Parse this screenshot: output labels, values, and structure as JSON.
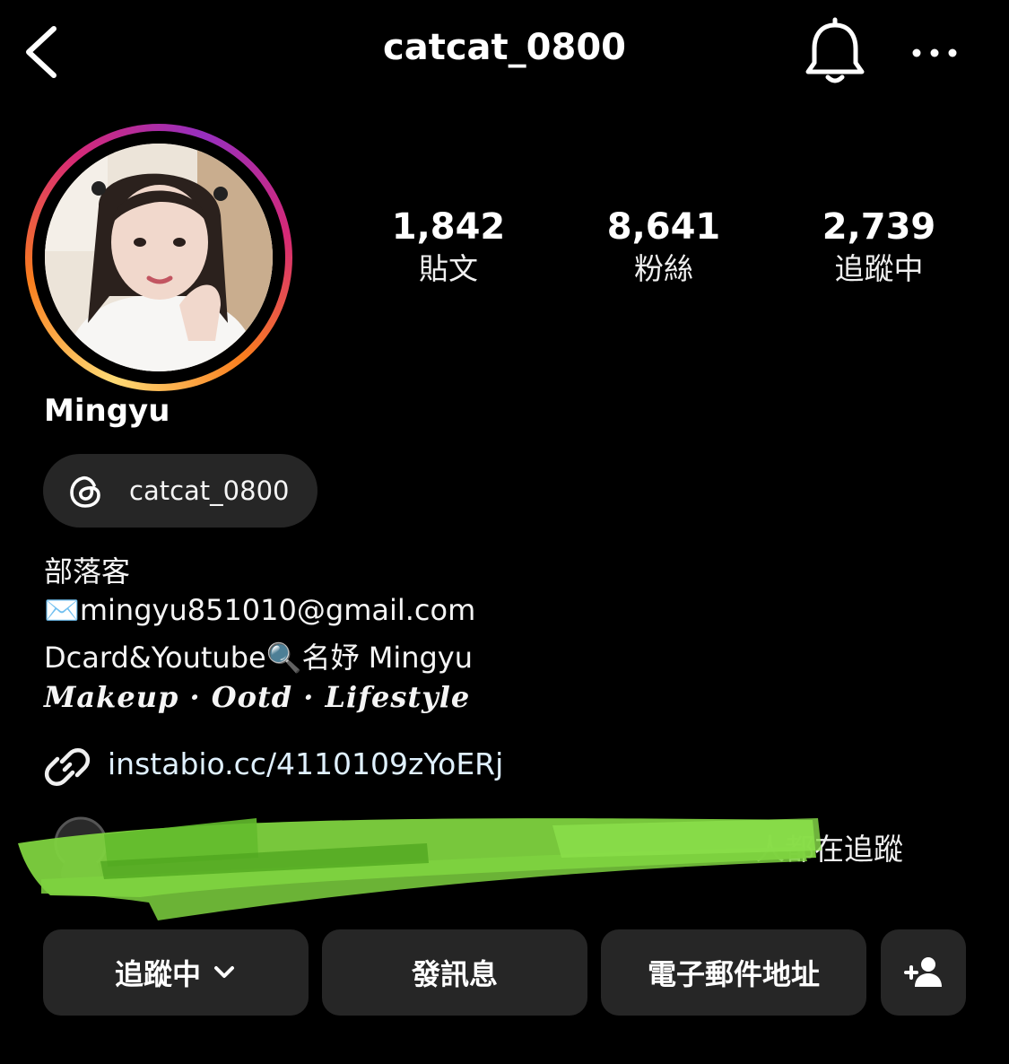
{
  "header": {
    "username": "catcat_0800"
  },
  "icons": {
    "back": "chevron-left-icon",
    "notifications": "bell-icon",
    "more": "more-horizontal-icon",
    "threads": "threads-icon",
    "link": "link-icon",
    "add_friend": "add-person-icon"
  },
  "profile": {
    "name": "Mingyu",
    "stats": [
      {
        "value": "1,842",
        "label": "貼文"
      },
      {
        "value": "8,641",
        "label": "粉絲"
      },
      {
        "value": "2,739",
        "label": "追蹤中"
      }
    ],
    "threads_handle": "catcat_0800",
    "bio": [
      "部落客",
      "✉️mingyu851010@gmail.com",
      "Dcard&Youtube🔍名妤 Mingyu"
    ],
    "bio_tagline": "Makeup · Ootd · Lifestyle",
    "link": "instabio.cc/4110109zYoERj",
    "followed_by_suffix": "人都在追蹤"
  },
  "actions": {
    "following": "追蹤中",
    "message": "發訊息",
    "email": "電子郵件地址"
  },
  "colors": {
    "background": "#000000",
    "button_bg": "#262626",
    "link_text": "#e0f1ff",
    "ring_gradient": [
      "#feda75",
      "#fa7e1e",
      "#d62976",
      "#962fbf"
    ],
    "redaction_scribble": "#7ed23f"
  }
}
